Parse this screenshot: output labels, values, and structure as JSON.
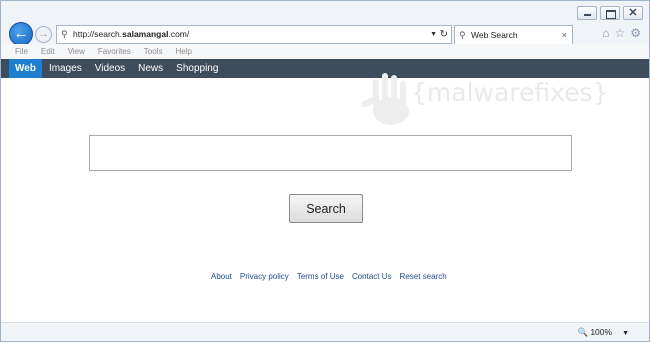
{
  "browser": {
    "url_prefix": "http://search.",
    "url_domain": "salamangal",
    "url_suffix": ".com/",
    "tab_title": "Web Search",
    "tab_close": "×",
    "back_glyph": "←",
    "forward_glyph": "→",
    "menu": [
      "File",
      "Edit",
      "View",
      "Favorites",
      "Tools",
      "Help"
    ],
    "zoom": "100%",
    "icons": [
      "home-icon",
      "star-icon",
      "gear-icon"
    ]
  },
  "nav": {
    "items": [
      "Web",
      "Images",
      "Videos",
      "News",
      "Shopping"
    ],
    "active_color": "#1e7fd1",
    "bar_color": "#3d4d5d"
  },
  "watermark": {
    "text": "{malwarefixes}"
  },
  "search": {
    "value": "",
    "button_label": "Search"
  },
  "footer": {
    "links": [
      "About",
      "Privacy policy",
      "Terms of Use",
      "Contact Us",
      "Reset search"
    ]
  }
}
